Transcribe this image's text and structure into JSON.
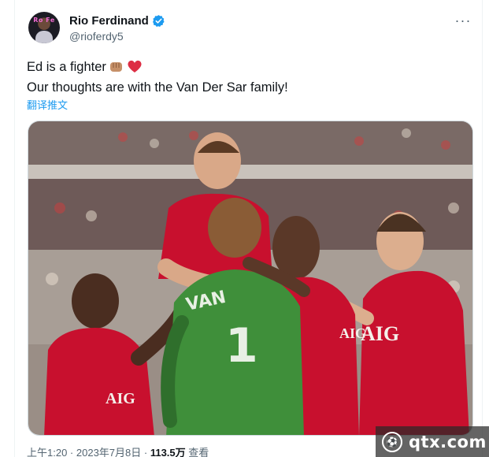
{
  "author": {
    "display_name": "Rio Ferdinand",
    "handle": "@rioferdy5",
    "avatar_text": "Ro Fe"
  },
  "icons": {
    "verified": "verified-badge-icon",
    "more": "more-options-icon",
    "fist": "fist-emoji",
    "heart": "red-heart-emoji"
  },
  "tweet": {
    "line1": "Ed is a fighter",
    "line2": "Our thoughts are with the Van Der Sar family!",
    "translate": "翻译推文"
  },
  "media": {
    "shirt_text": "AIG",
    "keeper_text": "VAN",
    "keeper_number": "1",
    "sponsor_text": "AIG"
  },
  "meta": {
    "time": "上午1:20",
    "separator1": " · ",
    "date": "2023年7月8日",
    "separator2": " · ",
    "views": "113.5万",
    "views_label": " 查看"
  },
  "watermark": {
    "text": "qtx.com"
  },
  "colors": {
    "link": "#1d9bf0",
    "verified": "#1d9bf0",
    "muted": "#536471",
    "united_red": "#c8102e",
    "keeper_green": "#3f8f3a"
  }
}
